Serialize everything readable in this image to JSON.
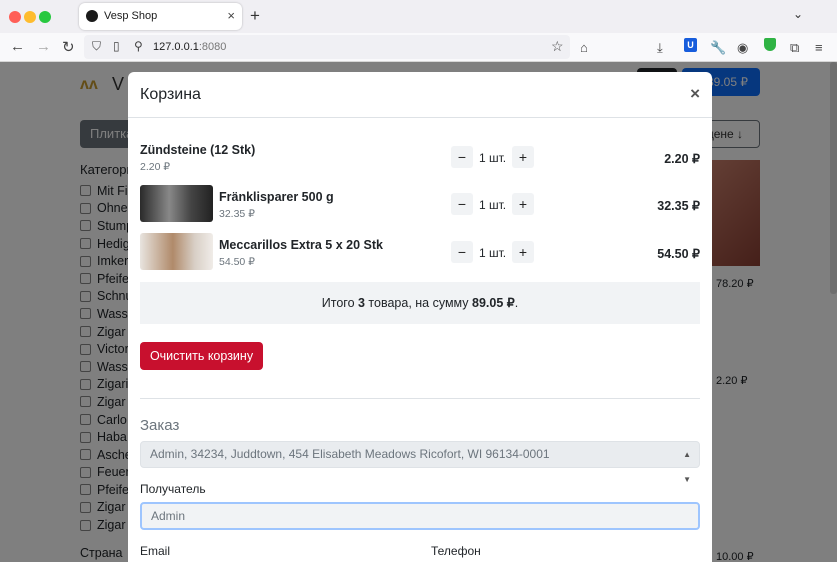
{
  "browser": {
    "tab_title": "Vesp Shop",
    "tab_close": "×",
    "new_tab": "+",
    "tabs_menu": "⌄",
    "url_host": "127.0.0.1",
    "url_port": ":8080",
    "icons": [
      "back-icon",
      "forward-icon",
      "reload-icon",
      "shield-icon",
      "page-icon",
      "site-settings-icon",
      "bookmark-star-icon",
      "home-icon",
      "downloads-icon",
      "bitwarden-icon",
      "wrench-icon",
      "extension-icon",
      "adblock-icon",
      "puzzle-icon",
      "menu-icon"
    ]
  },
  "page": {
    "logo_text": "V",
    "view_button": "Плитка",
    "sort_button": "цене ↓",
    "category_title": "Категори",
    "categories": [
      "Mit Fi",
      "Ohne",
      "Stump",
      "Hedig",
      "Imker",
      "Pfeife",
      "Schnu",
      "Wasse",
      "Zigar",
      "Victor",
      "Wasse",
      "Zigari",
      "Zigar",
      "Carlo",
      "Haba",
      "Asche",
      "Feuer",
      "Pfeife",
      "Zigar",
      "Zigar"
    ],
    "country_label": "Страна",
    "cart_button": "89.05 ₽",
    "side_prices": [
      "78.20 ₽",
      "2.20 ₽",
      "10.00 ₽"
    ]
  },
  "cart_modal": {
    "title": "Корзина",
    "close": "×",
    "items": [
      {
        "name": "Zündsteine (12 Stk)",
        "price": "2.20 ₽",
        "qty": "1 шт.",
        "total": "2.20 ₽",
        "has_image": false
      },
      {
        "name": "Fränklisparer 500 g",
        "price": "32.35 ₽",
        "qty": "1 шт.",
        "total": "32.35 ₽",
        "has_image": true
      },
      {
        "name": "Meccarillos Extra 5 x 20 Stk",
        "price": "54.50 ₽",
        "qty": "1 шт.",
        "total": "54.50 ₽",
        "has_image": true
      }
    ],
    "minus": "−",
    "plus": "+",
    "summary_prefix": "Итого ",
    "summary_count": "3",
    "summary_middle": " товара, на сумму ",
    "summary_total": "89.05 ₽",
    "summary_suffix": ".",
    "clear_button": "Очистить корзину",
    "order_title": "Заказ",
    "address_select": "Admin, 34234, Juddtown, 454 Elisabeth Meadows Ricofort, WI 96134-0001",
    "recipient_label": "Получатель",
    "recipient_placeholder": "Admin",
    "email_label": "Email",
    "phone_label": "Телефон"
  },
  "colors": {
    "primary": "#0d6efd",
    "danger": "#c8102e",
    "secondary": "#6c757d"
  }
}
